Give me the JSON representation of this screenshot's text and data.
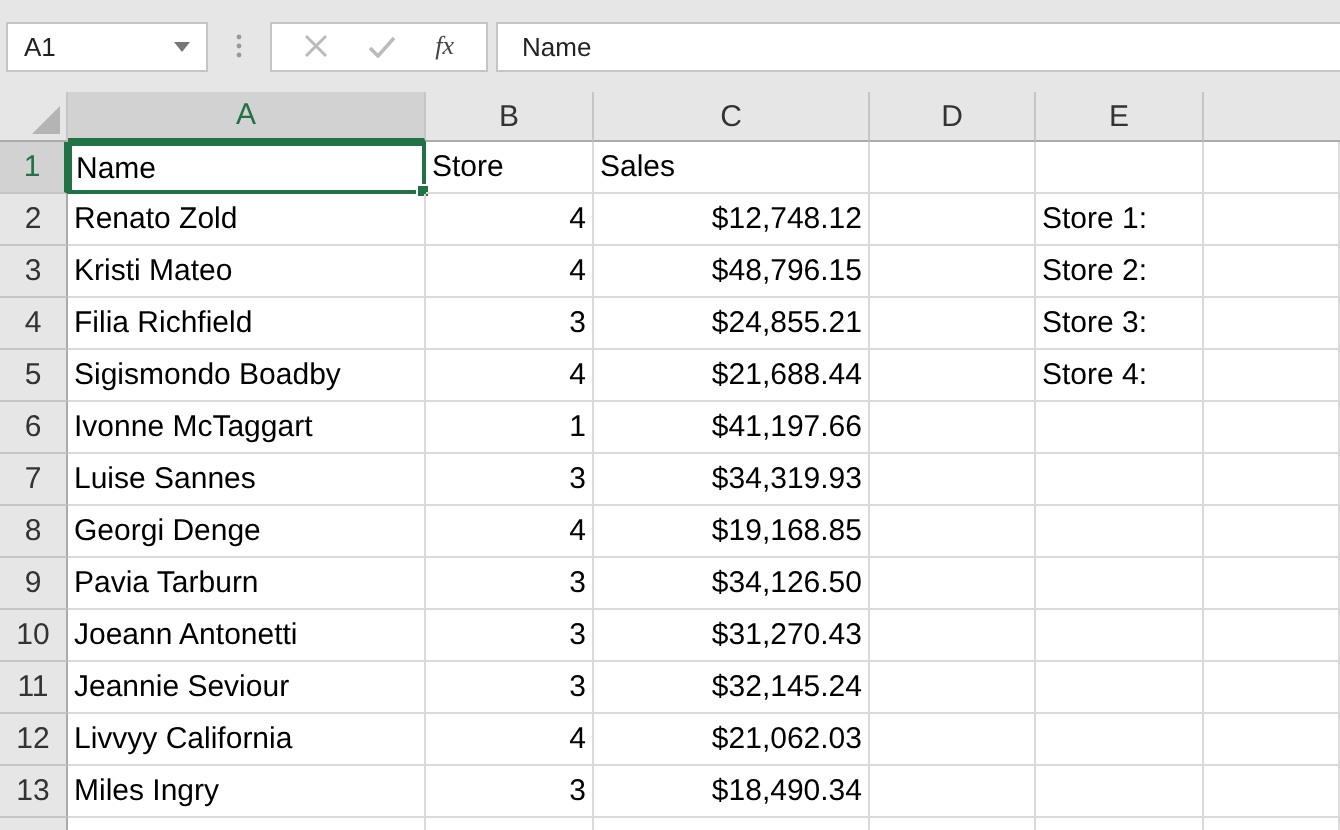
{
  "name_box": "A1",
  "function_button": "fx",
  "formula": "Name",
  "columns": [
    {
      "label": "A",
      "selected": true
    },
    {
      "label": "B",
      "selected": false
    },
    {
      "label": "C",
      "selected": false
    },
    {
      "label": "D",
      "selected": false
    },
    {
      "label": "E",
      "selected": false
    }
  ],
  "rows": [
    {
      "header": "1",
      "selected": true,
      "cells": [
        {
          "text": "Name",
          "kind": "text"
        },
        {
          "text": "Store",
          "kind": "text"
        },
        {
          "text": "Sales",
          "kind": "text"
        }
      ]
    },
    {
      "header": "2",
      "selected": false,
      "cells": [
        {
          "text": "Renato Zold",
          "kind": "text"
        },
        {
          "text": "4",
          "kind": "number"
        },
        {
          "text": "$12,748.12",
          "kind": "number"
        },
        null,
        {
          "text": "Store 1:",
          "kind": "text"
        }
      ]
    },
    {
      "header": "3",
      "selected": false,
      "cells": [
        {
          "text": "Kristi Mateo",
          "kind": "text"
        },
        {
          "text": "4",
          "kind": "number"
        },
        {
          "text": "$48,796.15",
          "kind": "number"
        },
        null,
        {
          "text": "Store 2:",
          "kind": "text"
        }
      ]
    },
    {
      "header": "4",
      "selected": false,
      "cells": [
        {
          "text": "Filia Richfield",
          "kind": "text"
        },
        {
          "text": "3",
          "kind": "number"
        },
        {
          "text": "$24,855.21",
          "kind": "number"
        },
        null,
        {
          "text": "Store 3:",
          "kind": "text"
        }
      ]
    },
    {
      "header": "5",
      "selected": false,
      "cells": [
        {
          "text": "Sigismondo Boadby",
          "kind": "text"
        },
        {
          "text": "4",
          "kind": "number"
        },
        {
          "text": "$21,688.44",
          "kind": "number"
        },
        null,
        {
          "text": "Store 4:",
          "kind": "text"
        }
      ]
    },
    {
      "header": "6",
      "selected": false,
      "cells": [
        {
          "text": "Ivonne McTaggart",
          "kind": "text"
        },
        {
          "text": "1",
          "kind": "number"
        },
        {
          "text": "$41,197.66",
          "kind": "number"
        }
      ]
    },
    {
      "header": "7",
      "selected": false,
      "cells": [
        {
          "text": "Luise Sannes",
          "kind": "text"
        },
        {
          "text": "3",
          "kind": "number"
        },
        {
          "text": "$34,319.93",
          "kind": "number"
        }
      ]
    },
    {
      "header": "8",
      "selected": false,
      "cells": [
        {
          "text": "Georgi Denge",
          "kind": "text"
        },
        {
          "text": "4",
          "kind": "number"
        },
        {
          "text": "$19,168.85",
          "kind": "number"
        }
      ]
    },
    {
      "header": "9",
      "selected": false,
      "cells": [
        {
          "text": "Pavia Tarburn",
          "kind": "text"
        },
        {
          "text": "3",
          "kind": "number"
        },
        {
          "text": "$34,126.50",
          "kind": "number"
        }
      ]
    },
    {
      "header": "10",
      "selected": false,
      "cells": [
        {
          "text": "Joeann Antonetti",
          "kind": "text"
        },
        {
          "text": "3",
          "kind": "number"
        },
        {
          "text": "$31,270.43",
          "kind": "number"
        }
      ]
    },
    {
      "header": "11",
      "selected": false,
      "cells": [
        {
          "text": "Jeannie Seviour",
          "kind": "text"
        },
        {
          "text": "3",
          "kind": "number"
        },
        {
          "text": "$32,145.24",
          "kind": "number"
        }
      ]
    },
    {
      "header": "12",
      "selected": false,
      "cells": [
        {
          "text": "Livvyy California",
          "kind": "text"
        },
        {
          "text": "4",
          "kind": "number"
        },
        {
          "text": "$21,062.03",
          "kind": "number"
        }
      ]
    },
    {
      "header": "13",
      "selected": false,
      "cells": [
        {
          "text": "Miles Ingry",
          "kind": "text"
        },
        {
          "text": "3",
          "kind": "number"
        },
        {
          "text": "$18,490.34",
          "kind": "number"
        }
      ]
    }
  ]
}
